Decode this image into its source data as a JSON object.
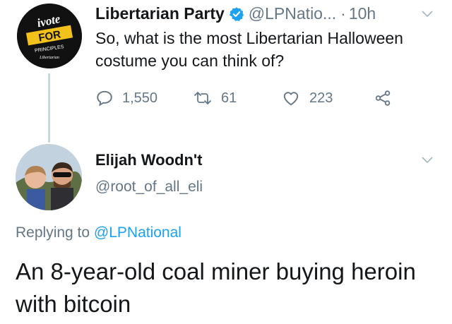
{
  "tweet": {
    "author_name": "Libertarian Party",
    "author_handle": "@LPNatio...",
    "separator": "·",
    "time": "10h",
    "text": "So, what is the most Libertarian Halloween costume you can think of?",
    "avatar_logo": {
      "line1": "ivote",
      "line2": "FOR",
      "line3": "PRINCIPLES",
      "line4": "Libertarian"
    },
    "stats": {
      "replies": "1,550",
      "retweets": "61",
      "likes": "223"
    }
  },
  "reply": {
    "author_name": "Elijah Woodn't",
    "author_handle": "@root_of_all_eli",
    "replying_prefix": "Replying to",
    "replying_mention": "@LPNational",
    "text": "An 8-year-old coal miner buying heroin with bitcoin"
  },
  "colors": {
    "text": "#14171a",
    "muted": "#657786",
    "link": "#1da1f2",
    "verified": "#1da1f2",
    "thread_line": "#ccd6dd"
  }
}
